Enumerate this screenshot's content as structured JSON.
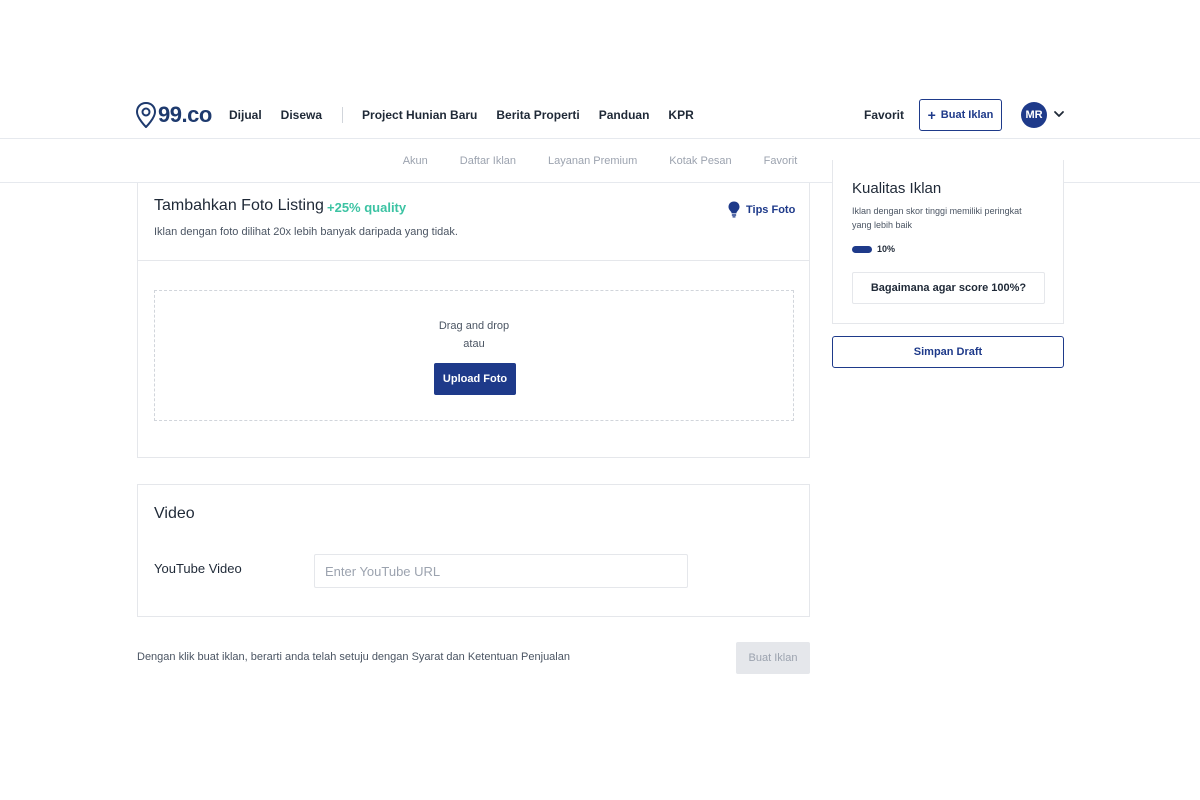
{
  "header": {
    "logo_text": "99.co",
    "nav_primary": [
      "Dijual",
      "Disewa"
    ],
    "nav_secondary": [
      "Project Hunian Baru",
      "Berita Properti",
      "Panduan",
      "KPR"
    ],
    "favorit_label": "Favorit",
    "create_ad_label": "Buat Iklan",
    "avatar_initials": "MR"
  },
  "subnav": {
    "items": [
      "Akun",
      "Daftar Iklan",
      "Layanan Premium",
      "Kotak Pesan",
      "Favorit"
    ]
  },
  "photo_section": {
    "title": "Tambahkan Foto Listing",
    "quality_badge": "+25% quality",
    "subtitle": "Iklan dengan foto dilihat 20x lebih banyak daripada yang tidak.",
    "tips_label": "Tips Foto",
    "drop_text": "Drag and drop",
    "or_text": "atau",
    "upload_label": "Upload Foto"
  },
  "video_section": {
    "title": "Video",
    "youtube_label": "YouTube Video",
    "youtube_value": "",
    "youtube_placeholder": "Enter YouTube URL"
  },
  "footer": {
    "terms_prefix": "Dengan klik buat iklan, berarti anda telah setuju dengan ",
    "terms_link": "Syarat dan Ketentuan Penjualan",
    "submit_label": "Buat Iklan"
  },
  "sidebar": {
    "quality_title": "Kualitas Iklan",
    "quality_desc": "Iklan dengan skor tinggi memiliki peringkat yang lebih baik",
    "quality_percent": "10%",
    "quality_value": 10,
    "how_label": "Bagaimana agar score 100%?",
    "save_draft_label": "Simpan Draft"
  },
  "colors": {
    "brand": "#1e3a8a",
    "accent_green": "#3cc3a3",
    "disabled_bg": "#e5e7eb"
  },
  "icons": [
    "location-pin-logo-icon",
    "chevron-down-icon",
    "plus-icon",
    "lightbulb-icon"
  ]
}
